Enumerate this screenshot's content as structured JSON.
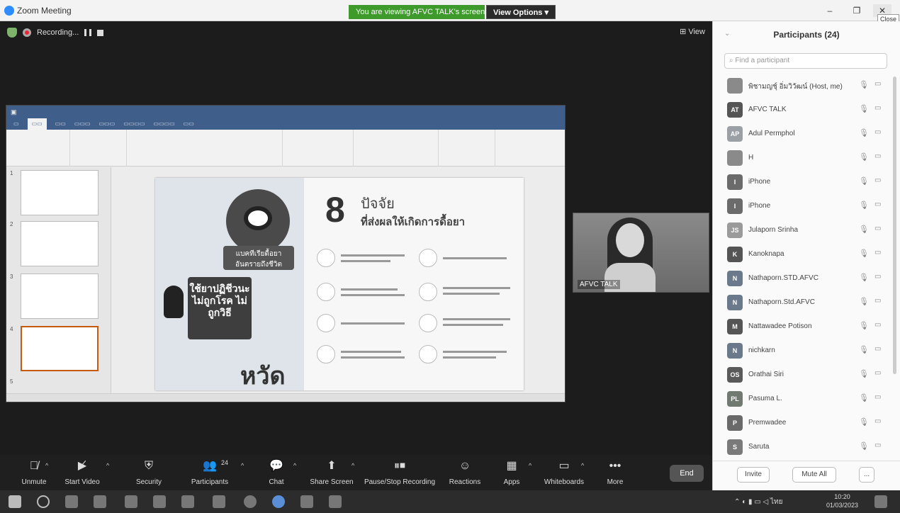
{
  "titlebar": {
    "app_title": "Zoom Meeting",
    "viewing_banner": "You are viewing AFVC TALK's screen",
    "view_options": "View Options",
    "close_tooltip": "Close"
  },
  "stage": {
    "recording_label": "Recording...",
    "view_label": "View"
  },
  "ppt": {
    "slide_heading_number": "8",
    "slide_heading_line1": "ปัจจัย",
    "slide_heading_line2": "ที่ส่งผลให้เกิดการดื้อยา",
    "slide_badge": "แบคทีเรียดื้อยา อันตรายถึงชีวิต",
    "slide_card": "ใช้ยาปฏิชีวนะ ไม่ถูกโรค ไม่ถูกวิธี",
    "slide_bottom_word": "หวัด",
    "thumb_numbers": [
      "1",
      "2",
      "3",
      "4",
      "5"
    ]
  },
  "speaker": {
    "name": "AFVC TALK"
  },
  "toolbar": {
    "unmute": "Unmute",
    "start_video": "Start Video",
    "security": "Security",
    "participants": "Participants",
    "participants_count": "24",
    "chat": "Chat",
    "share_screen": "Share Screen",
    "pause_recording": "Pause/Stop Recording",
    "reactions": "Reactions",
    "apps": "Apps",
    "whiteboards": "Whiteboards",
    "more": "More",
    "end": "End"
  },
  "panel": {
    "title": "Participants (24)",
    "search_placeholder": "Find a participant",
    "invite": "Invite",
    "mute_all": "Mute All",
    "more": "...",
    "participants": [
      {
        "initials": "",
        "name": "พิชามญชุ์ อิ่มวิวัฒน์ (Host, me)",
        "color": "#8a8a8a"
      },
      {
        "initials": "AT",
        "name": "AFVC TALK",
        "color": "#555555"
      },
      {
        "initials": "AP",
        "name": "Adul Permphol",
        "color": "#9aa0a6"
      },
      {
        "initials": "",
        "name": "H",
        "color": "#8a8a8a"
      },
      {
        "initials": "I",
        "name": "iPhone",
        "color": "#6b6b6b"
      },
      {
        "initials": "I",
        "name": "iPhone",
        "color": "#6b6b6b"
      },
      {
        "initials": "JS",
        "name": "Julaporn Srinha",
        "color": "#9a9a9a"
      },
      {
        "initials": "K",
        "name": "Kanoknapa",
        "color": "#555555"
      },
      {
        "initials": "N",
        "name": "Nathaporn.STD.AFVC",
        "color": "#6a7a8a"
      },
      {
        "initials": "N",
        "name": "Nathaporn.Std.AFVC",
        "color": "#6a7a8a"
      },
      {
        "initials": "M",
        "name": "Nattawadee Potison",
        "color": "#555555"
      },
      {
        "initials": "N",
        "name": "nichkarn",
        "color": "#6a7a8a"
      },
      {
        "initials": "OS",
        "name": "Orathai Siri",
        "color": "#5a5a5a"
      },
      {
        "initials": "PL",
        "name": "Pasuma L.",
        "color": "#707a70"
      },
      {
        "initials": "P",
        "name": "Premwadee",
        "color": "#6a6a6a"
      },
      {
        "initials": "S",
        "name": "Saruta",
        "color": "#7a7a7a"
      }
    ]
  },
  "taskbar": {
    "time": "10:20",
    "date": "01/03/2023",
    "lang": "ไทย"
  }
}
